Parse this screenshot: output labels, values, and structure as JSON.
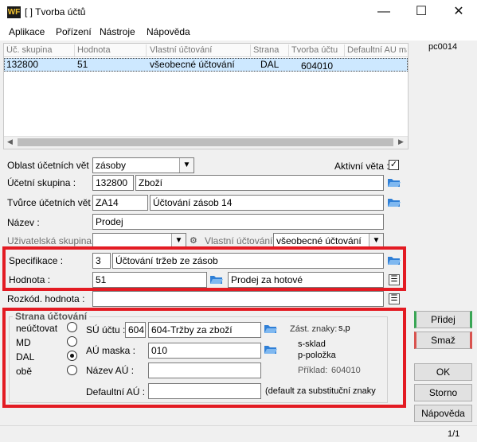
{
  "window": {
    "title": "[ ] Tvorba účtů",
    "logo": "WF",
    "minimize_icon": "—",
    "maximize_icon": "☐",
    "close_icon": "✕"
  },
  "menu": [
    "Aplikace",
    "Pořízení",
    "Nástroje",
    "Nápověda"
  ],
  "user_code": "pc0014",
  "grid": {
    "columns": [
      "Úč. skupina",
      "Hodnota",
      "Vlastní účtování",
      "Strana",
      "Tvorba účtu",
      "Defaultní AU ma"
    ],
    "rows": [
      [
        "132800",
        "51",
        "všeobecné účtování",
        "DAL",
        "604010",
        ""
      ]
    ]
  },
  "form": {
    "oblast_label": "Oblast účetních vět :",
    "oblast_value": "zásoby",
    "aktivni_label": "Aktivní věta :",
    "aktivni_checked": "✓",
    "skupina_label": "Účetní skupina :",
    "skupina_code": "132800",
    "skupina_name": "Zboží",
    "tvurce_label": "Tvůrce účetních vět :",
    "tvurce_code": "ZA14",
    "tvurce_name": "Účtování zásob 14",
    "nazev_label": "Název :",
    "nazev_value": "Prodej",
    "uziv_label": "Uživatelská skupina :",
    "uziv_value": "",
    "vlastni_label": "Vlastní účtování :",
    "vlastni_value": "všeobecné účtování",
    "spec_label": "Specifikace :",
    "spec_code": "3",
    "spec_name": "Účtování tržeb ze zásob",
    "hodnota_label": "Hodnota :",
    "hodnota_value": "51",
    "hodnota_name": "Prodej za hotové",
    "rozkod_label": "Rozkód. hodnota :",
    "rozkod_value": ""
  },
  "strana": {
    "title": "Strana účtování",
    "options": [
      "neúčtovat",
      "MD",
      "DAL",
      "obě"
    ],
    "selected": "DAL",
    "su_label": "SÚ účtu :",
    "su_code": "604",
    "su_name": "604-Tržby za zboží",
    "au_label": "AÚ maska :",
    "au_value": "010",
    "nazev_au_label": "Název AÚ :",
    "nazev_au_value": "",
    "default_au_label": "Defaultní AÚ :",
    "default_au_value": "",
    "default_note": "(default za substituční znaky",
    "zast_label": "Zást. znaky:",
    "zast_value": "s,p",
    "legend1": "s-sklad",
    "legend2": "p-položka",
    "priklad_label": "Příklad:",
    "priklad_value": "604010"
  },
  "buttons": {
    "pridej": "Přidej",
    "smaz": "Smaž",
    "ok": "OK",
    "storno": "Storno",
    "napoveda": "Nápověda"
  },
  "status": {
    "page": "1/1"
  },
  "colors": {
    "highlight_box": "#e31b23",
    "row_selected": "#cde8ff",
    "pridej_accent": "#3aa655",
    "smaz_accent": "#d9534f"
  }
}
